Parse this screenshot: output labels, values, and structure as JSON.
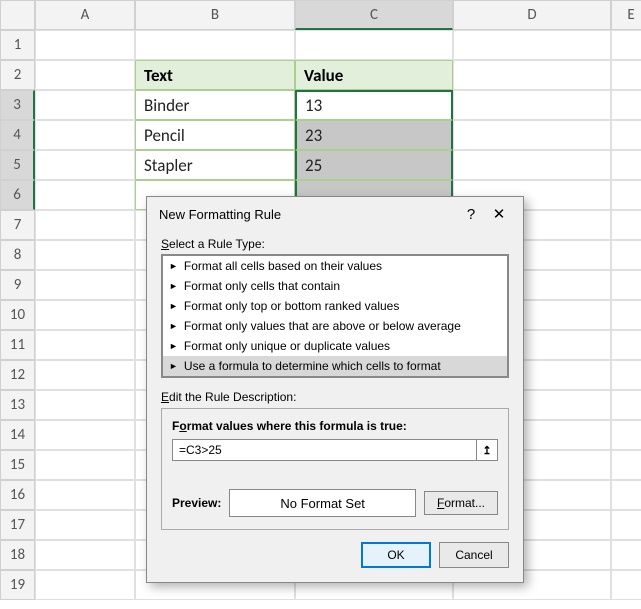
{
  "columns": [
    "A",
    "B",
    "C",
    "D",
    "E"
  ],
  "rows": [
    "1",
    "2",
    "3",
    "4",
    "5",
    "6",
    "7",
    "8",
    "9",
    "10",
    "11",
    "12",
    "13",
    "14",
    "15",
    "16",
    "17",
    "18",
    "19"
  ],
  "table": {
    "headers": {
      "text": "Text",
      "value": "Value"
    },
    "data": [
      {
        "text": "Binder",
        "value": "13"
      },
      {
        "text": "Pencil",
        "value": "23"
      },
      {
        "text": "Stapler",
        "value": "25"
      }
    ]
  },
  "dialog": {
    "title": "New Formatting Rule",
    "help": "?",
    "close": "✕",
    "select_label": "Select a Rule Type:",
    "rules": {
      "r0": "Format all cells based on their values",
      "r1": "Format only cells that contain",
      "r2": "Format only top or bottom ranked values",
      "r3": "Format only values that are above or below average",
      "r4": "Format only unique or duplicate values",
      "r5": "Use a formula to determine which cells to format"
    },
    "edit_label": "Edit the Rule Description:",
    "formula_label": "Format values where this formula is true:",
    "formula_value": "=C3>25",
    "preview_label": "Preview:",
    "preview_text": "No Format Set",
    "format_btn": "Format...",
    "ok": "OK",
    "cancel": "Cancel"
  }
}
